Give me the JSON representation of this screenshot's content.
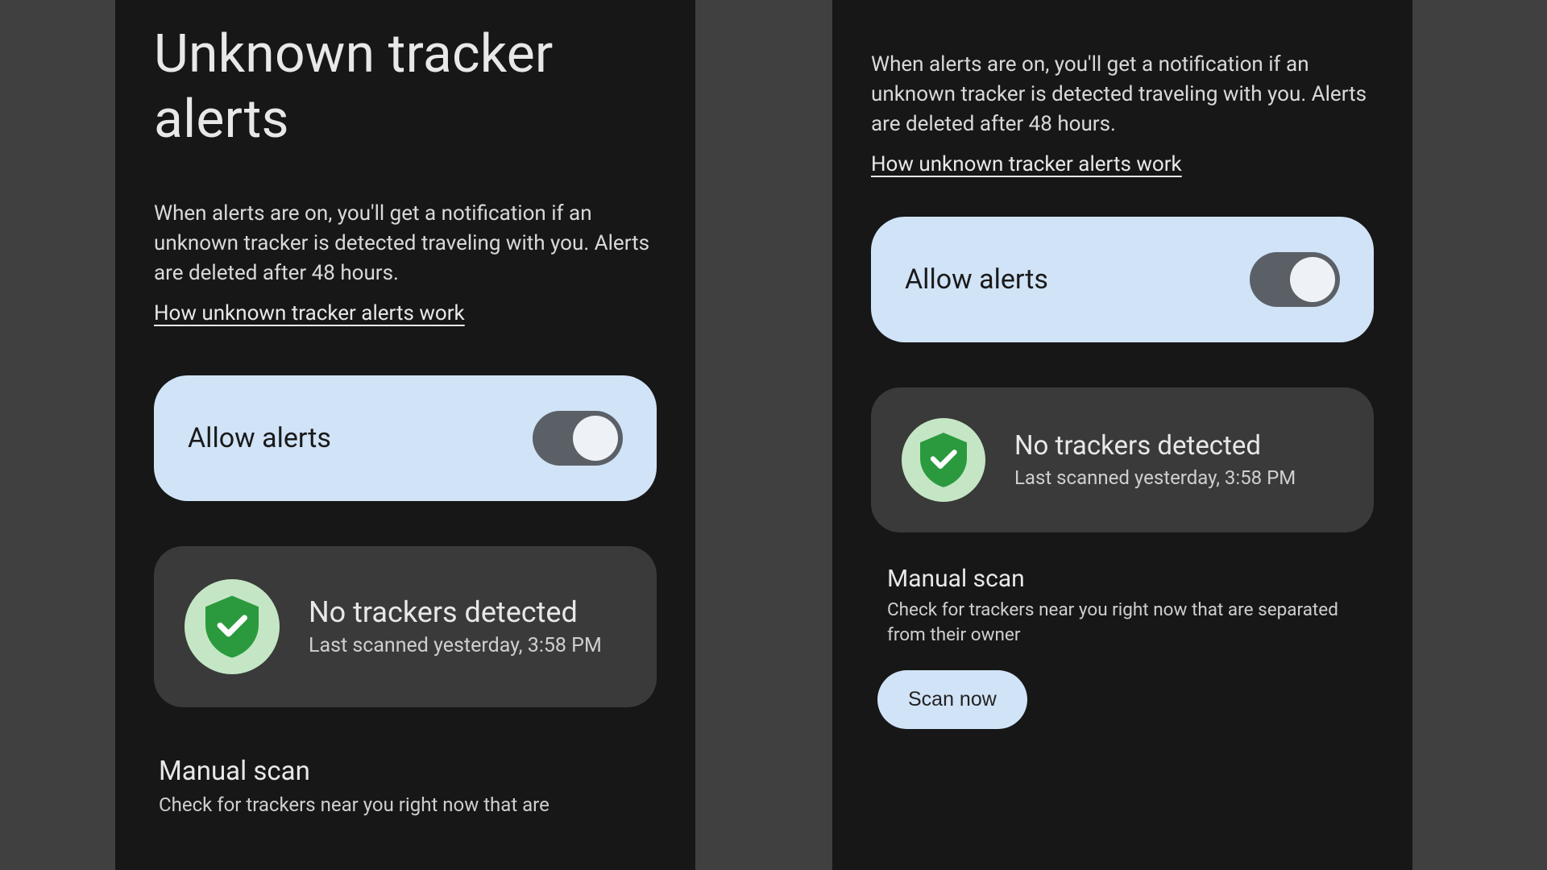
{
  "page_title": "Unknown tracker alerts",
  "description": "When alerts are on, you'll get a notification if an unknown tracker is detected traveling with you. Alerts are deleted after 48 hours.",
  "learn_more_label": "How unknown tracker alerts work",
  "allow_card": {
    "label": "Allow alerts",
    "enabled": true
  },
  "status": {
    "title": "No trackers detected",
    "subtitle": "Last scanned yesterday, 3:58 PM"
  },
  "manual_scan": {
    "title": "Manual scan",
    "description_full": "Check for trackers near you right now that are separated from their owner",
    "description_cut": "Check for trackers near you right now that are",
    "button_label": "Scan now"
  }
}
